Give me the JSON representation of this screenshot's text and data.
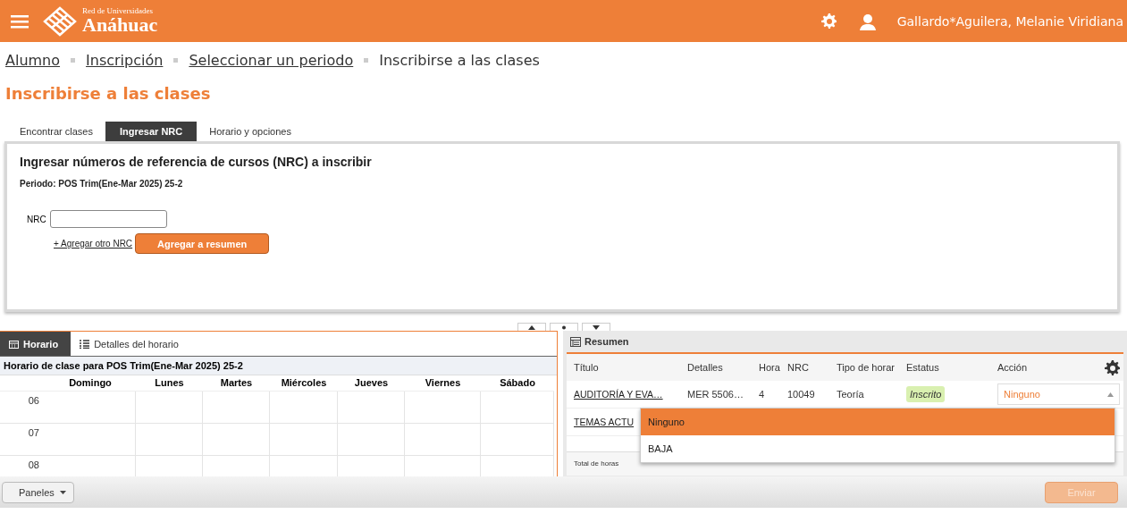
{
  "header": {
    "logo_small": "Red de Universidades",
    "logo_name": "Anáhuac",
    "user": "Gallardo*Aguilera, Melanie Viridiana"
  },
  "breadcrumb": [
    {
      "label": "Alumno",
      "link": true
    },
    {
      "label": "Inscripción",
      "link": true
    },
    {
      "label": "Seleccionar un periodo",
      "link": true
    },
    {
      "label": "Inscribirse a las clases",
      "link": false
    }
  ],
  "page_title": "Inscribirse a las clases",
  "tabs": [
    {
      "label": "Encontrar clases",
      "selected": false
    },
    {
      "label": "Ingresar NRC",
      "selected": true
    },
    {
      "label": "Horario y opciones",
      "selected": false
    }
  ],
  "nrc_panel": {
    "heading": "Ingresar números de referencia de cursos (NRC) a inscribir",
    "period": "Periodo: POS Trim(Ene-Mar 2025) 25-2",
    "nrc_label": "NRC",
    "add_link": "+ Agregar otro NRC",
    "add_button": "Agregar a resumen"
  },
  "schedule": {
    "tabs": [
      {
        "label": "Horario",
        "selected": true,
        "kind": "calendar"
      },
      {
        "label": "Detalles del horario",
        "selected": false,
        "kind": "list"
      }
    ],
    "caption": "Horario de clase para POS Trim(Ene-Mar 2025) 25-2",
    "days": [
      "Domingo",
      "Lunes",
      "Martes",
      "Miércoles",
      "Jueves",
      "Viernes",
      "Sábado"
    ],
    "hours": [
      "06",
      "07",
      "08"
    ]
  },
  "summary": {
    "title": "Resumen",
    "columns": [
      "Título",
      "Detalles",
      "Hora",
      "NRC",
      "Tipo de horar",
      "Estatus",
      "Acción"
    ],
    "rows": [
      {
        "title": "AUDITORÍA Y EVA…",
        "details": "MER 5506…",
        "hours": "4",
        "nrc": "10049",
        "type": "Teoría",
        "status": "Inscrito",
        "action": "Ninguno"
      },
      {
        "title": "TEMAS ACTU"
      }
    ],
    "total": "Total de horas",
    "dropdown": [
      {
        "label": "Ninguno",
        "selected": true
      },
      {
        "label": "BAJA",
        "selected": false
      }
    ]
  },
  "footer": {
    "panels_button": "Paneles",
    "submit": {
      "label": "Enviar",
      "disabled": true
    }
  }
}
